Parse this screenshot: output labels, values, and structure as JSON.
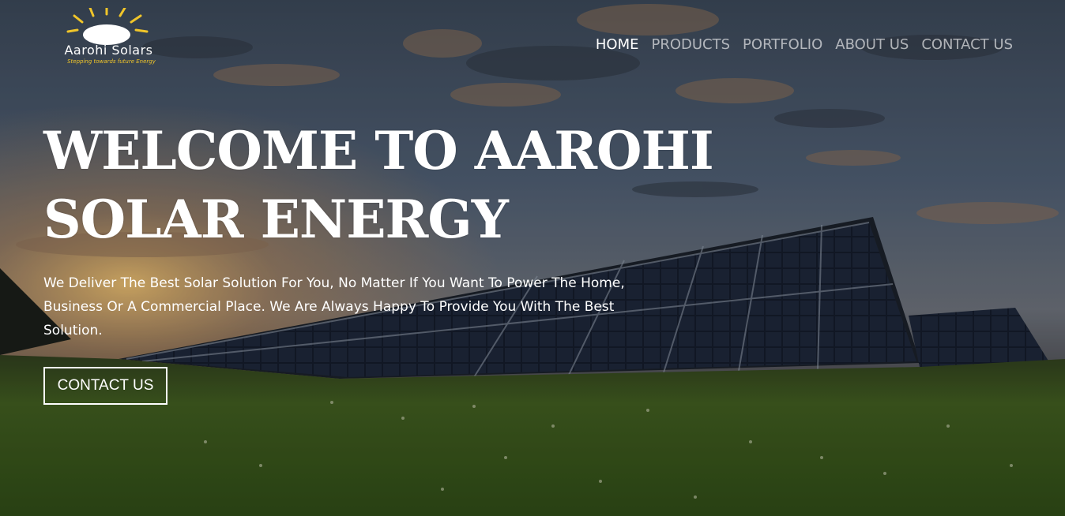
{
  "brand": {
    "name": "Aarohi Solars",
    "tagline": "Stepping towards future Energy"
  },
  "nav": {
    "items": [
      {
        "label": "HOME",
        "active": true
      },
      {
        "label": "PRODUCTS",
        "active": false
      },
      {
        "label": "PORTFOLIO",
        "active": false
      },
      {
        "label": "ABOUT US",
        "active": false
      },
      {
        "label": "CONTACT US",
        "active": false
      }
    ]
  },
  "hero": {
    "title_line1": "WELCOME TO AAROHI",
    "title_line2": "SOLAR ENERGY",
    "description": "We Deliver The Best Solar Solution For You, No Matter If You Want To Power The Home, Business Or A Commercial Place. We Are Always Happy To Provide You With The Best Solution.",
    "cta_label": "CONTACT US"
  },
  "colors": {
    "text": "#ffffff",
    "nav_inactive": "#bfc3c8",
    "brand_sun": "#f0c52a"
  }
}
